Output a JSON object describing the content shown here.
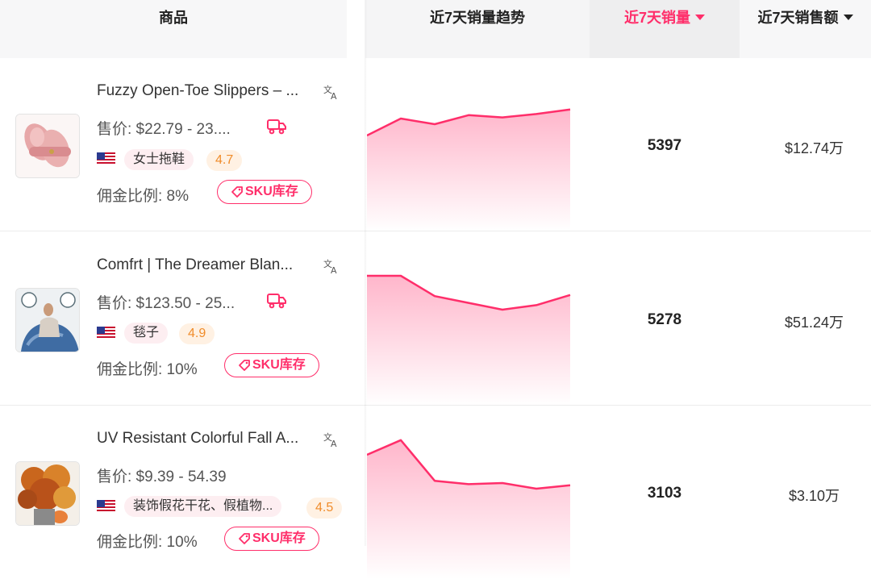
{
  "header": {
    "product": "商品",
    "trend": "近7天销量趋势",
    "sales": "近7天销量",
    "revenue": "近7天销售额"
  },
  "colors": {
    "accent": "#ff2e6a",
    "rating": "#f08c2a"
  },
  "rows": [
    {
      "title": "Fuzzy Open-Toe Slippers – ...",
      "price": "售价:  $22.79 - 23....",
      "has_truck": true,
      "flag": "US",
      "category": "女士拖鞋",
      "rating": "4.7",
      "commission": "佣金比例:  8%",
      "sku_label": "SKU库存",
      "sales": "5397",
      "revenue": "$12.74万",
      "trend": [
        10,
        25,
        20,
        28,
        26,
        29,
        33
      ]
    },
    {
      "title": "Comfrt | The Dreamer Blan...",
      "price": "售价:  $123.50 - 25...",
      "has_truck": true,
      "flag": "US",
      "category": "毯子",
      "rating": "4.9",
      "commission": "佣金比例:  10%",
      "sku_label": "SKU库存",
      "sales": "5278",
      "revenue": "$51.24万",
      "trend": [
        40,
        40,
        22,
        16,
        10,
        14,
        23
      ]
    },
    {
      "title": "UV Resistant Colorful Fall A...",
      "price": "售价:  $9.39 - 54.39",
      "has_truck": false,
      "flag": "US",
      "category": "装饰假花干花、假植物...",
      "rating": "4.5",
      "commission": "佣金比例:  10%",
      "sku_label": "SKU库存",
      "sales": "3103",
      "revenue": "$3.10万",
      "trend": [
        35,
        48,
        12,
        9,
        10,
        5,
        8
      ]
    }
  ]
}
